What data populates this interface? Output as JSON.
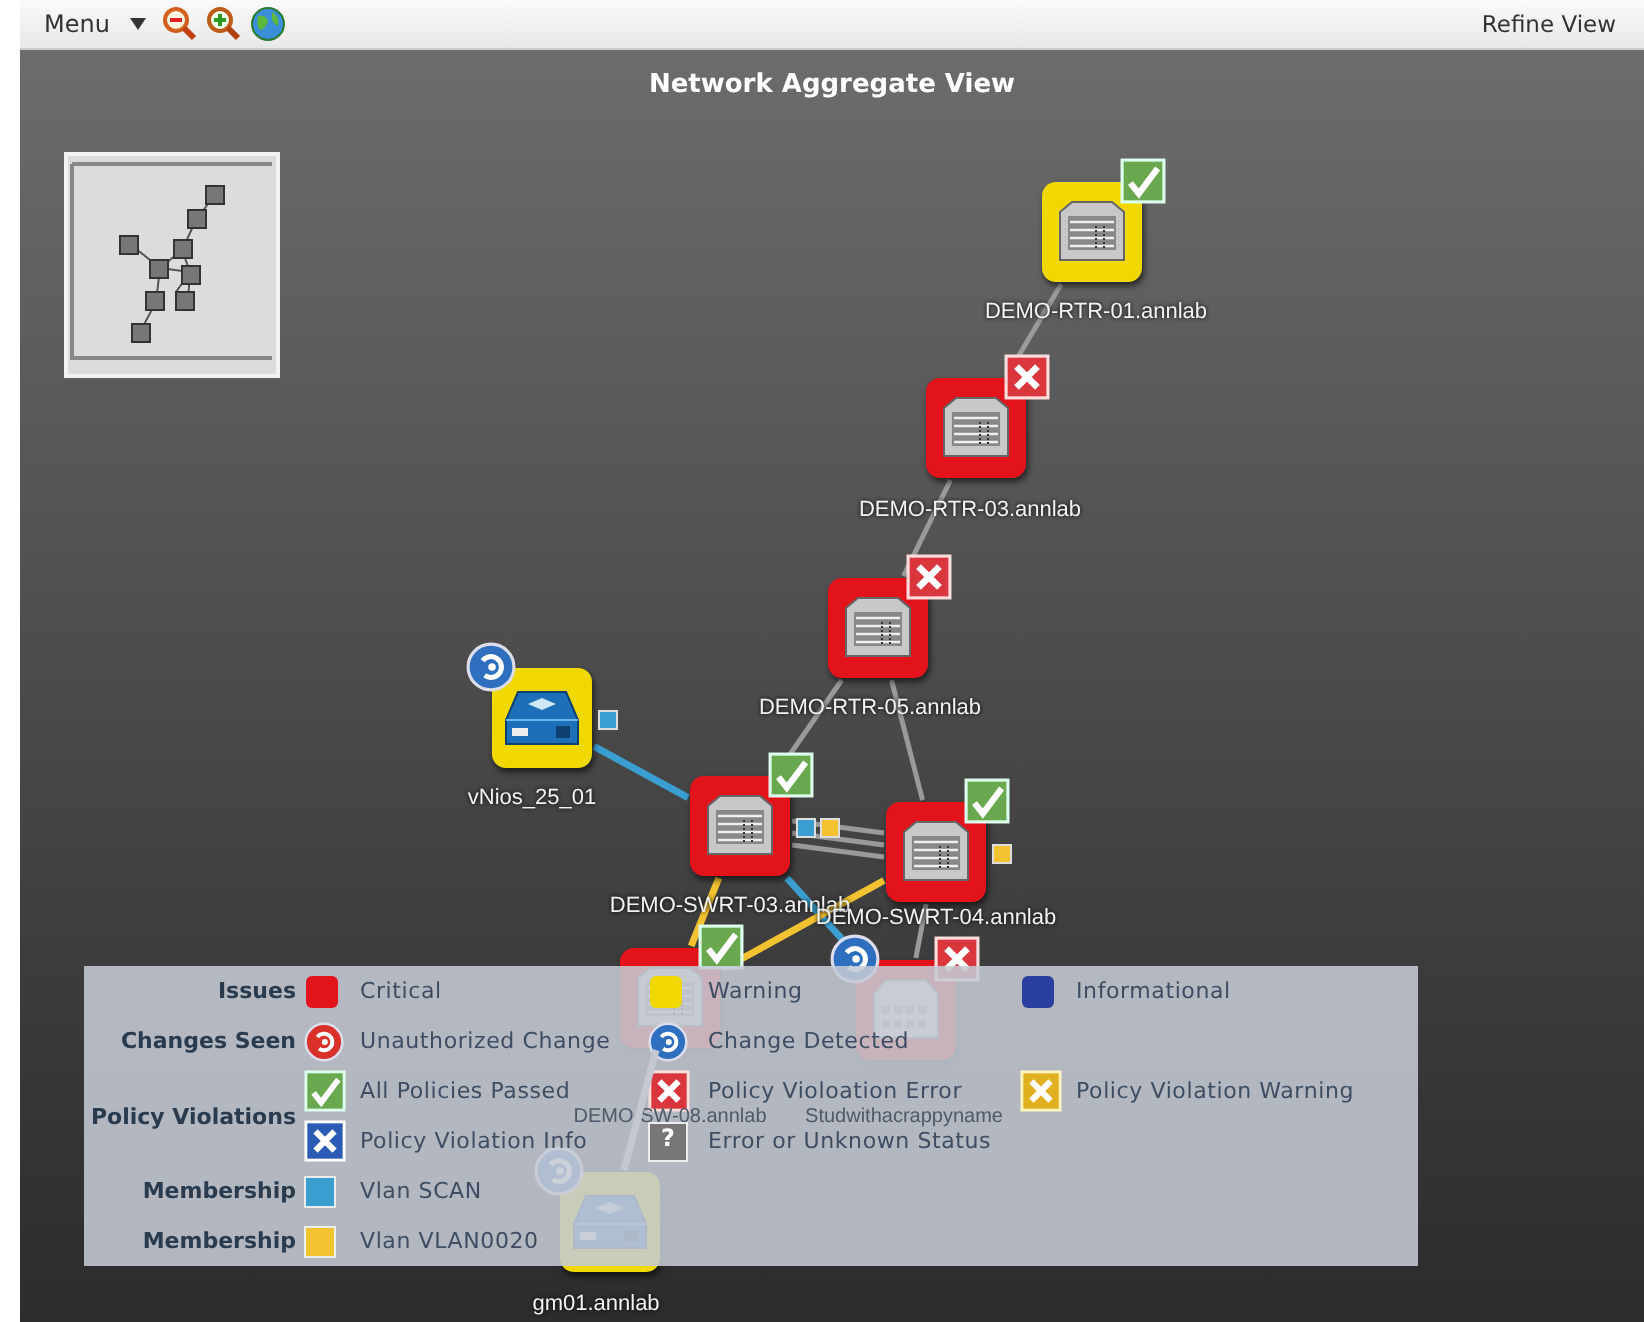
{
  "toolbar": {
    "menu": "Menu",
    "refine": "Refine View"
  },
  "canvas": {
    "title": "Network Aggregate View",
    "nodes": [
      {
        "label": "DEMO-RTR-01.annlab",
        "color": "#f1d800",
        "kind": "router",
        "badge": {
          "kind": "passed"
        },
        "change_detected": false
      },
      {
        "label": "DEMO-RTR-03.annlab",
        "color": "#e3131b",
        "kind": "router",
        "badge": {
          "kind": "error"
        },
        "change_detected": false
      },
      {
        "label": "DEMO-RTR-05.annlab",
        "color": "#e3131b",
        "kind": "router",
        "badge": {
          "kind": "error"
        },
        "change_detected": false
      },
      {
        "label": "vNios_25_01",
        "color": "#f1d800",
        "kind": "switch",
        "change_detected": true,
        "vlans": [
          {
            "color": "#3a9fd0"
          }
        ]
      },
      {
        "label": "DEMO-SWRT-03.annlab",
        "color": "#e3131b",
        "kind": "router",
        "badge": {
          "kind": "passed"
        },
        "change_detected": false,
        "vlans": [
          {
            "color": "#3a9fd0"
          },
          {
            "color": "#f2c230"
          }
        ]
      },
      {
        "label": "DEMO-SWRT-04.annlab",
        "color": "#e3131b",
        "kind": "router",
        "badge": {
          "kind": "passed"
        },
        "change_detected": false,
        "vlans": [
          {
            "color": "#f2c230"
          }
        ]
      },
      {
        "label": "DEMO-SW-08.annlab",
        "color": "#e3131b",
        "kind": "router",
        "badge": {
          "kind": "passed"
        },
        "change_detected": false
      },
      {
        "label": "Studwithacrappyname",
        "color": "#e3131b",
        "kind": "server",
        "badge": {
          "kind": "error"
        },
        "change_detected": true
      },
      {
        "label": "gm01.annlab",
        "color": "#f1d800",
        "kind": "switch",
        "change_detected": true
      }
    ],
    "links": [
      {
        "color": "#9a9a9a"
      },
      {
        "color": "#9a9a9a"
      },
      {
        "color": "#9a9a9a"
      },
      {
        "color": "#9a9a9a"
      },
      {
        "color": "#9a9a9a"
      },
      {
        "color": "#9a9a9a"
      },
      {
        "color": "#9a9a9a"
      },
      {
        "color": "#3a9fd0"
      },
      {
        "color": "#f2c230"
      },
      {
        "color": "#3a9fd0"
      },
      {
        "color": "#f2c230"
      },
      {
        "color": "#9a9a9a"
      },
      {
        "color": "#c4c9d1"
      }
    ]
  },
  "legend": [
    {
      "heading": "Issues",
      "lines": [
        [
          {
            "kind": "critical",
            "text": "Critical"
          },
          {
            "kind": "warning",
            "text": "Warning"
          },
          {
            "kind": "informational",
            "text": "Informational"
          }
        ]
      ]
    },
    {
      "heading": "Changes Seen",
      "lines": [
        [
          {
            "kind": "unauthorized",
            "text": "Unauthorized Change"
          },
          {
            "kind": "detected",
            "text": "Change Detected"
          }
        ]
      ]
    },
    {
      "heading": "Policy Violations",
      "lines": [
        [
          {
            "kind": "passed",
            "text": "All Policies Passed"
          },
          {
            "kind": "error",
            "text": "Policy Violoation Error"
          },
          {
            "kind": "pwarning",
            "text": "Policy Violation Warning"
          }
        ],
        [
          {
            "kind": "info",
            "text": "Policy  Violation Info"
          },
          {
            "kind": "unknown",
            "symbol": "?",
            "text": "Error or Unknown Status"
          }
        ]
      ]
    },
    {
      "heading": "Membership",
      "lines": [
        [
          {
            "kind": "vlan",
            "color": "#3a9fd0",
            "text": "Vlan SCAN"
          }
        ]
      ]
    },
    {
      "heading": "Membership",
      "lines": [
        [
          {
            "kind": "vlan",
            "color": "#f2c230",
            "text": "Vlan VLAN0020"
          }
        ]
      ]
    }
  ]
}
